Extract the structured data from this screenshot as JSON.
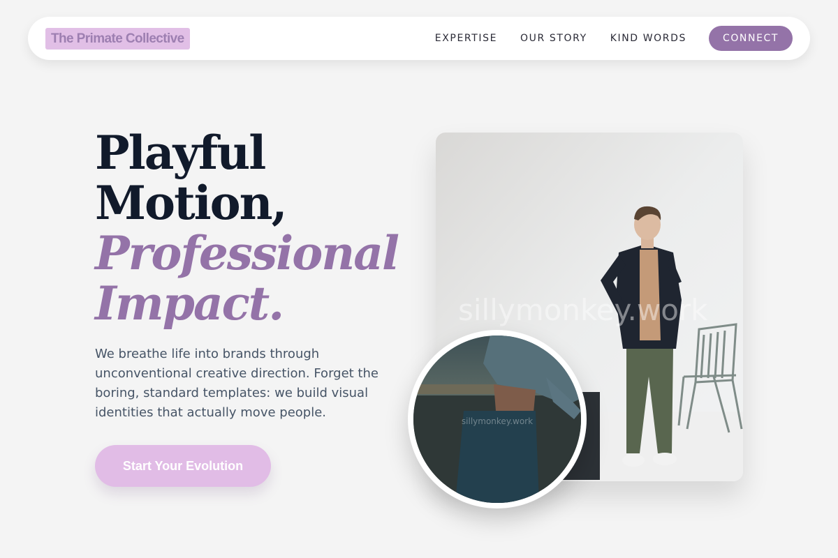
{
  "brand": {
    "name": "The Primate Collective",
    "accent_color": "#9473a8",
    "highlight_color": "#e1bfe6"
  },
  "nav": {
    "links": [
      "EXPERTISE",
      "OUR STORY",
      "KIND WORDS"
    ],
    "cta": "CONNECT"
  },
  "hero": {
    "headline": {
      "line1": "Playful",
      "line2": "Motion,",
      "line3": "Professional",
      "line4": "Impact."
    },
    "lead": "We breathe life into brands through unconventional creative direction. Forget the boring, standard templates: we build visual identities that actually move people.",
    "cta": "Start Your Evolution",
    "main_image": {
      "watermark": "sillymonkey.work"
    },
    "circle_image": {
      "watermark": "sillymonkey.work"
    }
  }
}
